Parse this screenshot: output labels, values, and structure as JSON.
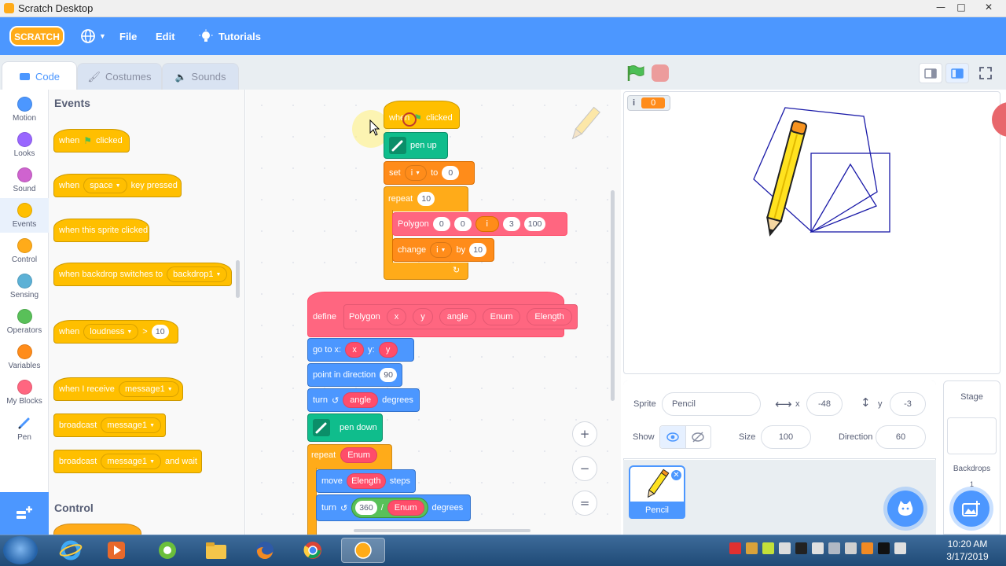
{
  "window": {
    "title": "Scratch Desktop",
    "controls": {
      "minimize": "—",
      "maximize": "□",
      "close": "✕"
    }
  },
  "menubar": {
    "logo_text": "SCRATCH",
    "language_icon": "globe-icon",
    "file": "File",
    "edit": "Edit",
    "tutorials": "Tutorials",
    "brand_color": "#4c97ff"
  },
  "tabs": {
    "code": "Code",
    "costumes": "Costumes",
    "sounds": "Sounds"
  },
  "categories": [
    {
      "label": "Motion",
      "color": "#4c97ff"
    },
    {
      "label": "Looks",
      "color": "#9966ff"
    },
    {
      "label": "Sound",
      "color": "#cf63cf"
    },
    {
      "label": "Events",
      "color": "#ffbf00"
    },
    {
      "label": "Control",
      "color": "#ffab19"
    },
    {
      "label": "Sensing",
      "color": "#5cb1d6"
    },
    {
      "label": "Operators",
      "color": "#59c059"
    },
    {
      "label": "Variables",
      "color": "#ff8c1a"
    },
    {
      "label": "My Blocks",
      "color": "#ff6680"
    },
    {
      "label": "Pen",
      "color": ""
    }
  ],
  "palette": {
    "events_heading": "Events",
    "control_heading": "Control",
    "when": "when",
    "clicked": "clicked",
    "space": "space",
    "key_pressed": "key pressed",
    "sprite_clicked": "when this sprite clicked",
    "backdrop_switches": "when backdrop switches to",
    "backdrop1": "backdrop1",
    "loudness": "loudness",
    "gt": ">",
    "loudness_value": "10",
    "receive": "when I receive",
    "message1": "message1",
    "broadcast": "broadcast",
    "and_wait": "and wait"
  },
  "script1": {
    "when": "when",
    "clicked": "clicked",
    "pen_up": "pen up",
    "set": "set",
    "var_i": "i",
    "to": "to",
    "set_value": "0",
    "repeat": "repeat",
    "repeat_count": "10",
    "polygon": "Polygon",
    "poly_args": [
      "0",
      "0",
      "i",
      "3",
      "100"
    ],
    "change": "change",
    "by": "by",
    "change_value": "10"
  },
  "script2": {
    "define": "define",
    "polygon": "Polygon",
    "params": [
      "x",
      "y",
      "angle",
      "Enum",
      "Elength"
    ],
    "go_to_x": "go to x:",
    "x": "x",
    "y_label": "y:",
    "y": "y",
    "point_in_direction": "point in direction",
    "direction": "90",
    "turn": "turn",
    "angle": "angle",
    "degrees": "degrees",
    "pen_down": "pen down",
    "repeat": "repeat",
    "enum": "Enum",
    "move": "move",
    "elength": "Elength",
    "steps": "steps",
    "turn_value": "360",
    "divide": "/"
  },
  "zoom": {
    "in": "+",
    "out": "−",
    "reset": "="
  },
  "stage": {
    "monitor_label": "i",
    "monitor_value": "0"
  },
  "sprite_info": {
    "sprite_label": "Sprite",
    "sprite_name": "Pencil",
    "x_label": "x",
    "x_value": "-48",
    "y_label": "y",
    "y_value": "-3",
    "show_label": "Show",
    "size_label": "Size",
    "size_value": "100",
    "direction_label": "Direction",
    "direction_value": "60"
  },
  "sprite_list": {
    "selected": "Pencil"
  },
  "stage_target": {
    "title": "Stage",
    "backdrops_label": "Backdrops",
    "backdrops_count": "1"
  },
  "taskbar": {
    "time": "10:20 AM",
    "date": "3/17/2019"
  }
}
